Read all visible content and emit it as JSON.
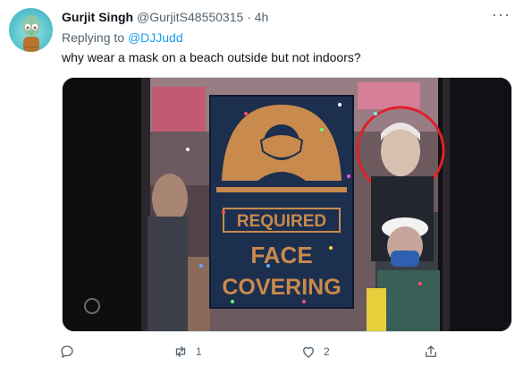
{
  "tweet": {
    "author": {
      "name": "Gurjit Singh",
      "handle": "@GurjitS48550315",
      "separator": "·",
      "time": "4h"
    },
    "more_icon": "more-dots-icon",
    "replying_to": {
      "prefix": "Replying to",
      "mention": "@DJJudd"
    },
    "text": "why wear a mask on a beach outside but not indoors?",
    "media": {
      "sign": {
        "line1": "REQUIRED",
        "line2": "FACE",
        "line3": "COVERING"
      }
    },
    "actions": {
      "reply_count": "",
      "retweet_count": "1",
      "like_count": "2"
    }
  },
  "colors": {
    "link": "#1d9bf0",
    "secondary_text": "#536471",
    "sign_background": "#1c2f4f",
    "sign_accent": "#c98a4d",
    "circle_highlight": "#e0202a"
  }
}
